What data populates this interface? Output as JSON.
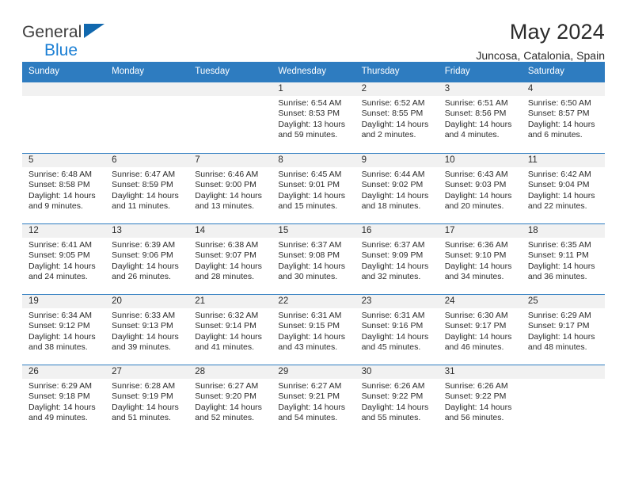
{
  "brand": {
    "line1": "General",
    "line2": "Blue",
    "triangle_color": "#1168ae"
  },
  "header": {
    "title": "May 2024",
    "location": "Juncosa, Catalonia, Spain"
  },
  "theme": {
    "header_blue": "#2e7cc0",
    "daynum_band": "#f1f1f1",
    "text": "#2b2b2b"
  },
  "calendar": {
    "day_headers": [
      "Sunday",
      "Monday",
      "Tuesday",
      "Wednesday",
      "Thursday",
      "Friday",
      "Saturday"
    ],
    "weeks": [
      [
        {
          "day": "",
          "empty": true
        },
        {
          "day": "",
          "empty": true
        },
        {
          "day": "",
          "empty": true
        },
        {
          "day": "1",
          "sunrise": "Sunrise: 6:54 AM",
          "sunset": "Sunset: 8:53 PM",
          "daylight1": "Daylight: 13 hours",
          "daylight2": "and 59 minutes."
        },
        {
          "day": "2",
          "sunrise": "Sunrise: 6:52 AM",
          "sunset": "Sunset: 8:55 PM",
          "daylight1": "Daylight: 14 hours",
          "daylight2": "and 2 minutes."
        },
        {
          "day": "3",
          "sunrise": "Sunrise: 6:51 AM",
          "sunset": "Sunset: 8:56 PM",
          "daylight1": "Daylight: 14 hours",
          "daylight2": "and 4 minutes."
        },
        {
          "day": "4",
          "sunrise": "Sunrise: 6:50 AM",
          "sunset": "Sunset: 8:57 PM",
          "daylight1": "Daylight: 14 hours",
          "daylight2": "and 6 minutes."
        }
      ],
      [
        {
          "day": "5",
          "sunrise": "Sunrise: 6:48 AM",
          "sunset": "Sunset: 8:58 PM",
          "daylight1": "Daylight: 14 hours",
          "daylight2": "and 9 minutes."
        },
        {
          "day": "6",
          "sunrise": "Sunrise: 6:47 AM",
          "sunset": "Sunset: 8:59 PM",
          "daylight1": "Daylight: 14 hours",
          "daylight2": "and 11 minutes."
        },
        {
          "day": "7",
          "sunrise": "Sunrise: 6:46 AM",
          "sunset": "Sunset: 9:00 PM",
          "daylight1": "Daylight: 14 hours",
          "daylight2": "and 13 minutes."
        },
        {
          "day": "8",
          "sunrise": "Sunrise: 6:45 AM",
          "sunset": "Sunset: 9:01 PM",
          "daylight1": "Daylight: 14 hours",
          "daylight2": "and 15 minutes."
        },
        {
          "day": "9",
          "sunrise": "Sunrise: 6:44 AM",
          "sunset": "Sunset: 9:02 PM",
          "daylight1": "Daylight: 14 hours",
          "daylight2": "and 18 minutes."
        },
        {
          "day": "10",
          "sunrise": "Sunrise: 6:43 AM",
          "sunset": "Sunset: 9:03 PM",
          "daylight1": "Daylight: 14 hours",
          "daylight2": "and 20 minutes."
        },
        {
          "day": "11",
          "sunrise": "Sunrise: 6:42 AM",
          "sunset": "Sunset: 9:04 PM",
          "daylight1": "Daylight: 14 hours",
          "daylight2": "and 22 minutes."
        }
      ],
      [
        {
          "day": "12",
          "sunrise": "Sunrise: 6:41 AM",
          "sunset": "Sunset: 9:05 PM",
          "daylight1": "Daylight: 14 hours",
          "daylight2": "and 24 minutes."
        },
        {
          "day": "13",
          "sunrise": "Sunrise: 6:39 AM",
          "sunset": "Sunset: 9:06 PM",
          "daylight1": "Daylight: 14 hours",
          "daylight2": "and 26 minutes."
        },
        {
          "day": "14",
          "sunrise": "Sunrise: 6:38 AM",
          "sunset": "Sunset: 9:07 PM",
          "daylight1": "Daylight: 14 hours",
          "daylight2": "and 28 minutes."
        },
        {
          "day": "15",
          "sunrise": "Sunrise: 6:37 AM",
          "sunset": "Sunset: 9:08 PM",
          "daylight1": "Daylight: 14 hours",
          "daylight2": "and 30 minutes."
        },
        {
          "day": "16",
          "sunrise": "Sunrise: 6:37 AM",
          "sunset": "Sunset: 9:09 PM",
          "daylight1": "Daylight: 14 hours",
          "daylight2": "and 32 minutes."
        },
        {
          "day": "17",
          "sunrise": "Sunrise: 6:36 AM",
          "sunset": "Sunset: 9:10 PM",
          "daylight1": "Daylight: 14 hours",
          "daylight2": "and 34 minutes."
        },
        {
          "day": "18",
          "sunrise": "Sunrise: 6:35 AM",
          "sunset": "Sunset: 9:11 PM",
          "daylight1": "Daylight: 14 hours",
          "daylight2": "and 36 minutes."
        }
      ],
      [
        {
          "day": "19",
          "sunrise": "Sunrise: 6:34 AM",
          "sunset": "Sunset: 9:12 PM",
          "daylight1": "Daylight: 14 hours",
          "daylight2": "and 38 minutes."
        },
        {
          "day": "20",
          "sunrise": "Sunrise: 6:33 AM",
          "sunset": "Sunset: 9:13 PM",
          "daylight1": "Daylight: 14 hours",
          "daylight2": "and 39 minutes."
        },
        {
          "day": "21",
          "sunrise": "Sunrise: 6:32 AM",
          "sunset": "Sunset: 9:14 PM",
          "daylight1": "Daylight: 14 hours",
          "daylight2": "and 41 minutes."
        },
        {
          "day": "22",
          "sunrise": "Sunrise: 6:31 AM",
          "sunset": "Sunset: 9:15 PM",
          "daylight1": "Daylight: 14 hours",
          "daylight2": "and 43 minutes."
        },
        {
          "day": "23",
          "sunrise": "Sunrise: 6:31 AM",
          "sunset": "Sunset: 9:16 PM",
          "daylight1": "Daylight: 14 hours",
          "daylight2": "and 45 minutes."
        },
        {
          "day": "24",
          "sunrise": "Sunrise: 6:30 AM",
          "sunset": "Sunset: 9:17 PM",
          "daylight1": "Daylight: 14 hours",
          "daylight2": "and 46 minutes."
        },
        {
          "day": "25",
          "sunrise": "Sunrise: 6:29 AM",
          "sunset": "Sunset: 9:17 PM",
          "daylight1": "Daylight: 14 hours",
          "daylight2": "and 48 minutes."
        }
      ],
      [
        {
          "day": "26",
          "sunrise": "Sunrise: 6:29 AM",
          "sunset": "Sunset: 9:18 PM",
          "daylight1": "Daylight: 14 hours",
          "daylight2": "and 49 minutes."
        },
        {
          "day": "27",
          "sunrise": "Sunrise: 6:28 AM",
          "sunset": "Sunset: 9:19 PM",
          "daylight1": "Daylight: 14 hours",
          "daylight2": "and 51 minutes."
        },
        {
          "day": "28",
          "sunrise": "Sunrise: 6:27 AM",
          "sunset": "Sunset: 9:20 PM",
          "daylight1": "Daylight: 14 hours",
          "daylight2": "and 52 minutes."
        },
        {
          "day": "29",
          "sunrise": "Sunrise: 6:27 AM",
          "sunset": "Sunset: 9:21 PM",
          "daylight1": "Daylight: 14 hours",
          "daylight2": "and 54 minutes."
        },
        {
          "day": "30",
          "sunrise": "Sunrise: 6:26 AM",
          "sunset": "Sunset: 9:22 PM",
          "daylight1": "Daylight: 14 hours",
          "daylight2": "and 55 minutes."
        },
        {
          "day": "31",
          "sunrise": "Sunrise: 6:26 AM",
          "sunset": "Sunset: 9:22 PM",
          "daylight1": "Daylight: 14 hours",
          "daylight2": "and 56 minutes."
        },
        {
          "day": "",
          "empty": true
        }
      ]
    ]
  }
}
